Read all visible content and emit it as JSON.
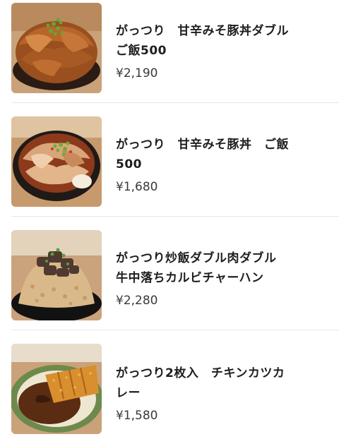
{
  "menu": {
    "items": [
      {
        "name_line1": "がっつり　甘辛みそ豚丼ダブル",
        "name_line2": "ご飯500",
        "price": "¥2,190",
        "image_icon": "pork-bowl-double-photo"
      },
      {
        "name_line1": "がっつり　甘辛みそ豚丼　ご飯",
        "name_line2": "500",
        "price": "¥1,680",
        "image_icon": "pork-bowl-photo"
      },
      {
        "name_line1": "がっつり炒飯ダブル肉ダブル",
        "name_line2": "牛中落ちカルビチャーハン",
        "price": "¥2,280",
        "image_icon": "fried-rice-photo"
      },
      {
        "name_line1": "がっつり2枚入　チキンカツカ",
        "name_line2": "レー",
        "price": "¥1,580",
        "image_icon": "chicken-katsu-curry-photo"
      }
    ]
  }
}
